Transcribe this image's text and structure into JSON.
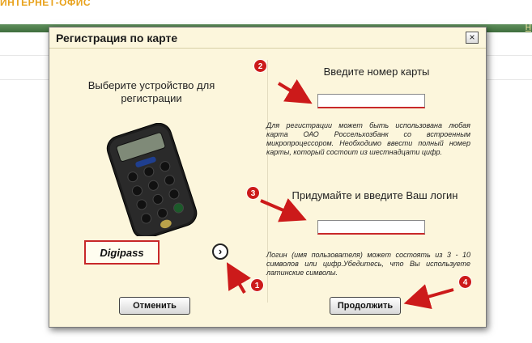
{
  "site": {
    "title": "ИНТЕРНЕТ-ОФИС",
    "nav_link": "Н"
  },
  "dialog": {
    "title": "Регистрация по карте",
    "close_symbol": "×",
    "left": {
      "heading": "Выберите устройство для регистрации",
      "device_name": "Digipass",
      "next_symbol": "›"
    },
    "right": {
      "card_heading": "Введите номер карты",
      "card_input_value": "",
      "card_help": "Для регистрации может быть использована любая карта ОАО Россельхозбанк со встроенным микропроцессором. Необходимо ввести полный номер карты, который состоит из шестнадцати цифр.",
      "login_heading": "Придумайте и введите Ваш логин",
      "login_input_value": "",
      "login_help": "Логин (имя пользователя) может состоять из 3 - 10 символов или цифр.Убедитесь, что Вы используете латинские символы."
    },
    "buttons": {
      "cancel": "Отменить",
      "continue": "Продолжить"
    }
  },
  "annotations": {
    "markers": [
      "1",
      "2",
      "3",
      "4"
    ],
    "color": "#cc1a1a"
  },
  "icons": [
    "close-icon",
    "chevron-right-icon",
    "token-device-icon"
  ]
}
